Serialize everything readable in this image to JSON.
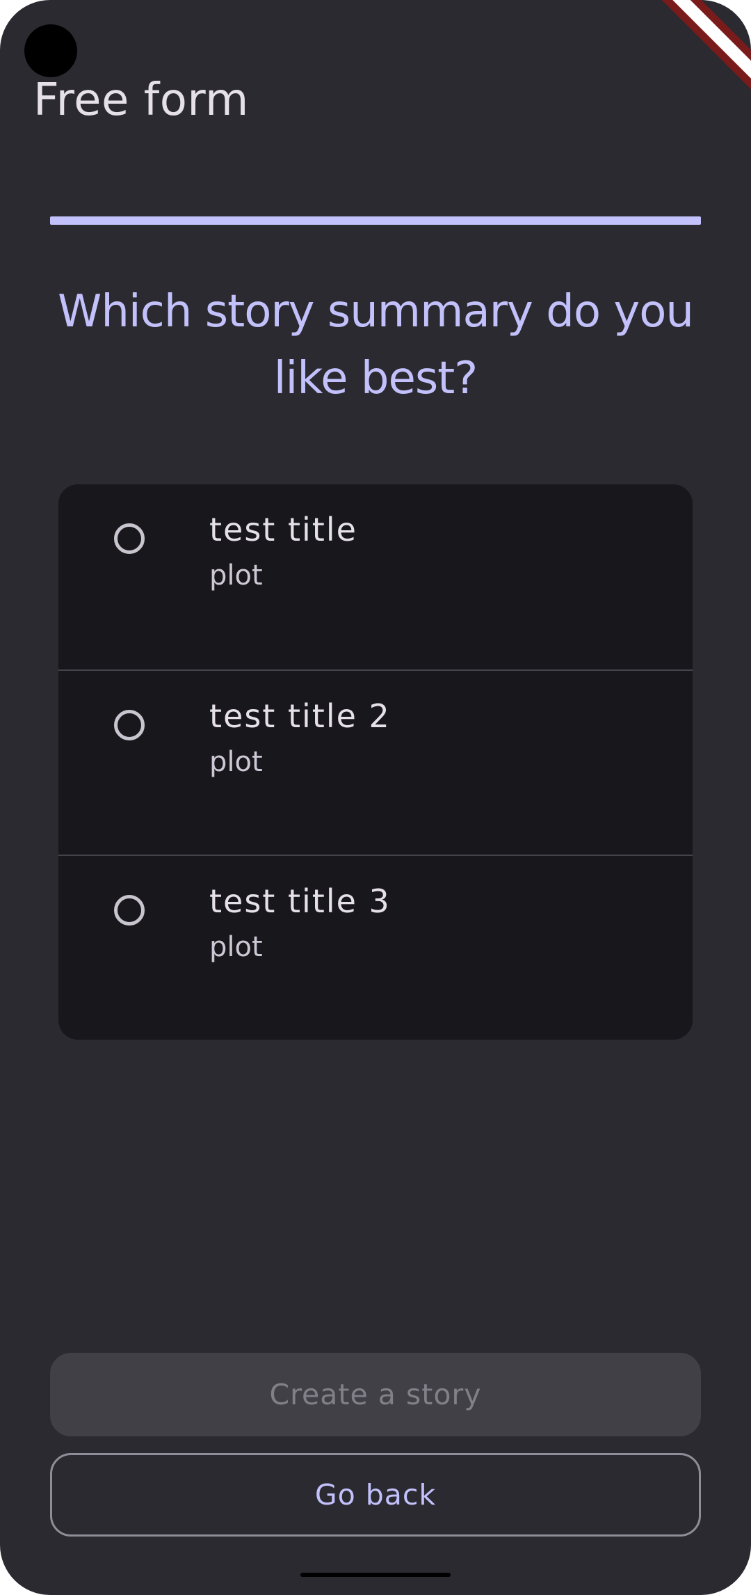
{
  "app_bar": {
    "title": "Free form"
  },
  "progress": {
    "value": 1.0,
    "track_color": "#403f55",
    "fill_color": "#c3c1fb"
  },
  "question": {
    "text": "Which story summary do you like best?"
  },
  "options": [
    {
      "title": "test title",
      "plot": "plot",
      "selected": false
    },
    {
      "title": "test title 2",
      "plot": "plot",
      "selected": false
    },
    {
      "title": "test title 3",
      "plot": "plot",
      "selected": false
    }
  ],
  "buttons": {
    "create_label": "Create a story",
    "create_enabled": false,
    "back_label": "Go back"
  },
  "icons": {
    "radio": "radio-unchecked-icon",
    "camera": "camera-cutout",
    "debug": "debug-banner"
  },
  "colors": {
    "background": "#2b2a30",
    "accent": "#c3c1fb",
    "card": "#18171c",
    "text_primary": "#e6e1e9",
    "disabled_bg": "#414047",
    "disabled_text": "#818088"
  }
}
